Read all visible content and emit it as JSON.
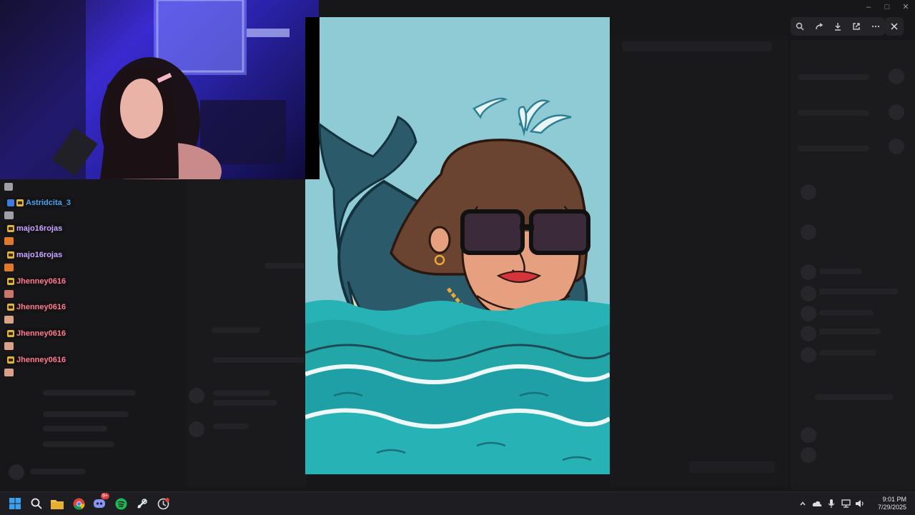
{
  "chat": {
    "messages": [
      {
        "user": "",
        "color": "#9ea0a6",
        "badges": [],
        "emote": "pencil"
      },
      {
        "user": "Astridcita_3",
        "color": "#4aa3f0",
        "badges": [
          "blue",
          "crown"
        ],
        "emote": "pencil"
      },
      {
        "user": "majo16rojas",
        "color": "#c8a4ff",
        "badges": [
          "crown"
        ],
        "emote": "orange"
      },
      {
        "user": "majo16rojas",
        "color": "#c8a4ff",
        "badges": [
          "crown"
        ],
        "emote": "orange"
      },
      {
        "user": "Jhenney0616",
        "color": "#ff7a8a",
        "badges": [
          "crown"
        ],
        "emote": "face"
      },
      {
        "user": "Jhenney0616",
        "color": "#ff7a8a",
        "badges": [
          "crown"
        ],
        "emote": "face"
      },
      {
        "user": "Jhenney0616",
        "color": "#ff7a8a",
        "badges": [
          "crown"
        ],
        "emote": "face"
      },
      {
        "user": "Jhenney0616",
        "color": "#ff7a8a",
        "badges": [
          "crown"
        ],
        "emote": "face"
      }
    ]
  },
  "viewer": {
    "toolbar": [
      "zoom-icon",
      "share-icon",
      "download-icon",
      "open-external-icon",
      "more-icon"
    ]
  },
  "taskbar": {
    "apps": [
      "windows-start-icon",
      "search-icon",
      "file-explorer-icon",
      "chrome-icon",
      "discord-icon",
      "spotify-icon",
      "steam-icon",
      "overlay-app-icon"
    ],
    "discord_badge": "9+",
    "time": "9:01 PM",
    "date": "7/29/2025"
  },
  "colors": {
    "sky": "#8fcbd4",
    "whale": "#2b5b6b",
    "sea": "#27b3b5",
    "gold": "#e8a93a"
  }
}
